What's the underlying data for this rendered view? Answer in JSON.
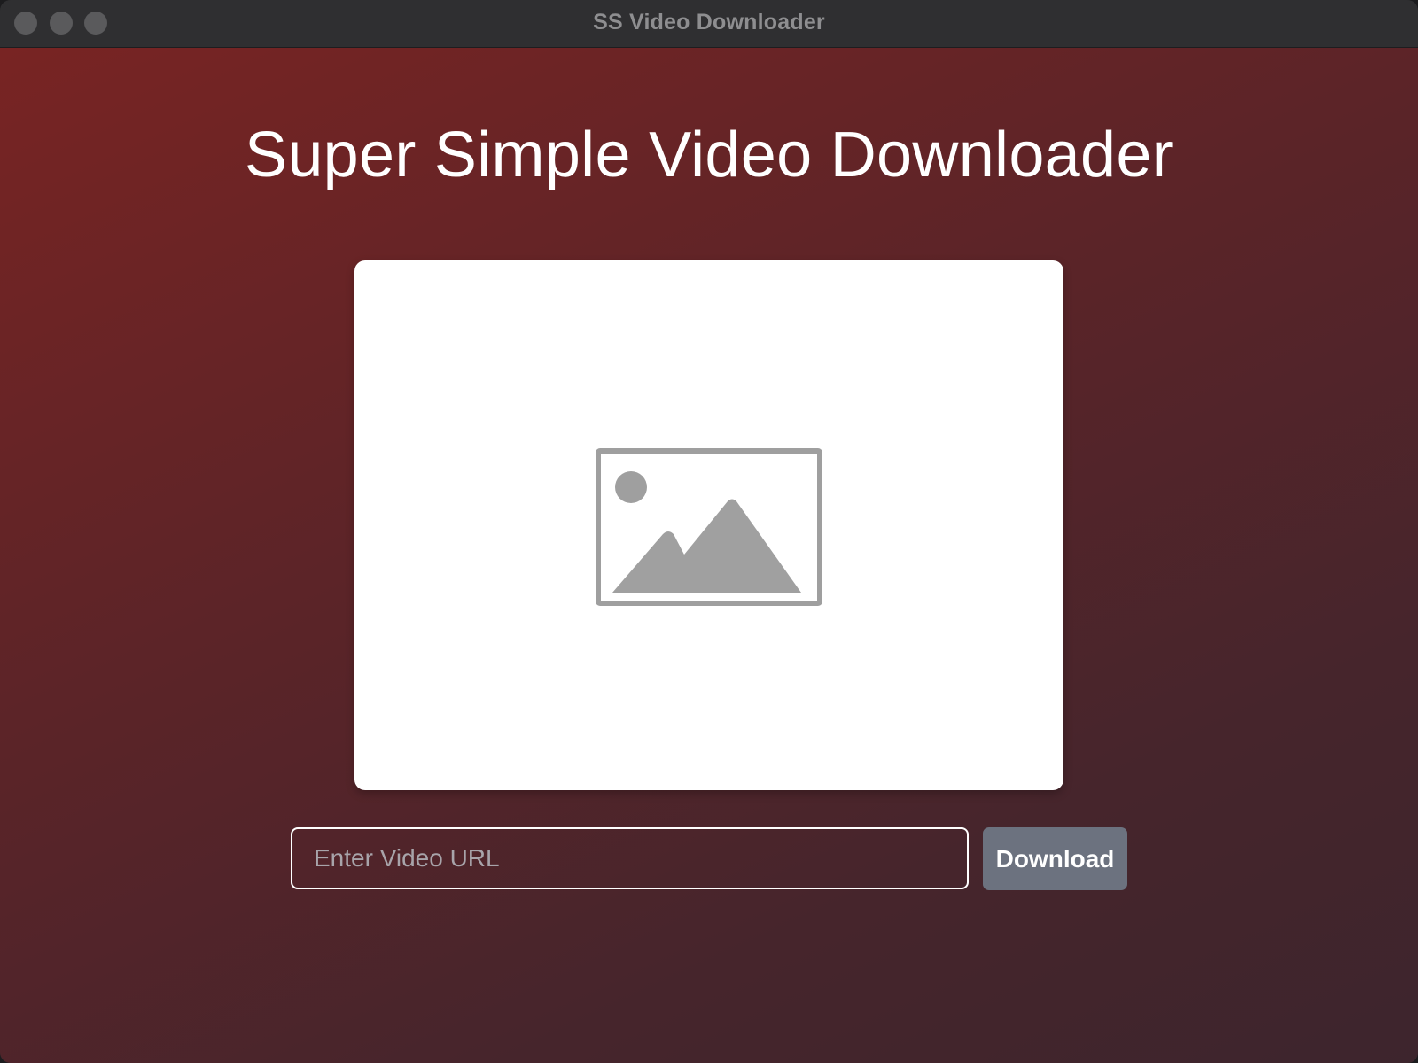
{
  "window": {
    "title": "SS Video Downloader"
  },
  "app": {
    "heading": "Super Simple Video Downloader"
  },
  "preview": {
    "icon": "image-placeholder-icon"
  },
  "form": {
    "url_placeholder": "Enter Video URL",
    "url_value": "",
    "download_label": "Download"
  },
  "colors": {
    "gradient_start": "#782423",
    "gradient_end": "#3d252d",
    "button_background": "#6c727f"
  }
}
